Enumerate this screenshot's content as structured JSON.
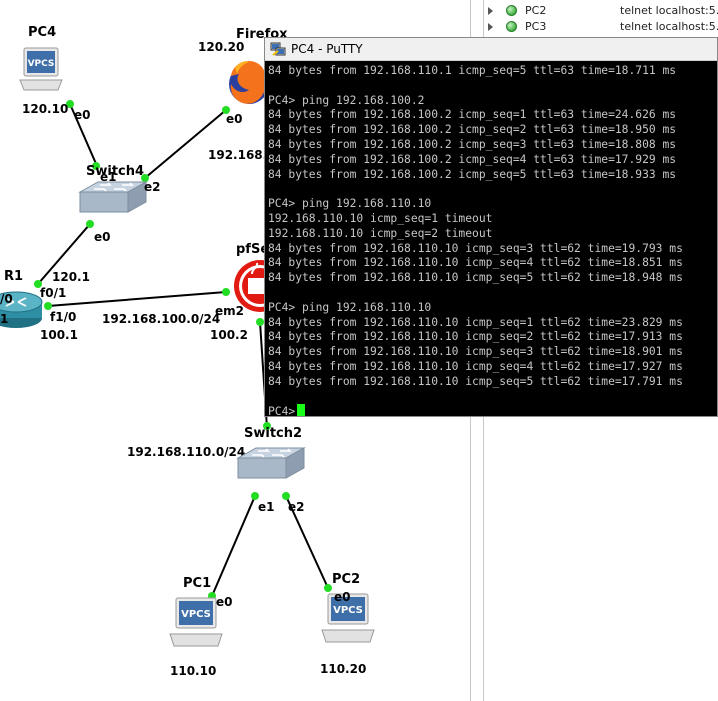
{
  "topology": {
    "nodes": {
      "pc4": {
        "name": "PC4",
        "ip": "120.10",
        "port": "e0",
        "icon_text": "VPCS"
      },
      "firefox": {
        "name": "Firefox",
        "ip_top": "120.20",
        "port": "e0",
        "ip_bottom": "192.168."
      },
      "switch4": {
        "name": "Switch4",
        "port_e1": "e1",
        "port_e2": "e2",
        "port_e0": "e0"
      },
      "r1": {
        "name": "R1",
        "ip_top": "120.1",
        "port_f01": "f0/1",
        "port_f10": "f1/0",
        "ip_bottom": "100.1",
        "port_left_top": "/0",
        "port_left_bottom": "1"
      },
      "pfsense": {
        "name": "pfSe",
        "port_em2": "em2",
        "ip": "100.2"
      },
      "switch2": {
        "name": "Switch2"
      },
      "pc1": {
        "name": "PC1",
        "port": "e0",
        "ip": "110.10",
        "icon_text": "VPCS"
      },
      "pc2": {
        "name": "PC2",
        "port": "e0",
        "ip": "110.20",
        "icon_text": "VPCS"
      }
    },
    "links": {
      "net_100": "192.168.100.0/24",
      "net_110": "192.168.110.0/24",
      "sw2_e1": "e1",
      "sw2_e2": "e2"
    }
  },
  "devices_panel": {
    "rows": [
      {
        "name": "PC2",
        "console": "telnet localhost:5...",
        "status": "started"
      },
      {
        "name": "PC3",
        "console": "telnet localhost:5...",
        "status": "started"
      }
    ]
  },
  "putty": {
    "title": "PC4 - PuTTY",
    "lines": [
      "84 bytes from 192.168.110.1 icmp_seq=5 ttl=63 time=18.711 ms",
      "",
      "PC4> ping 192.168.100.2",
      "84 bytes from 192.168.100.2 icmp_seq=1 ttl=63 time=24.626 ms",
      "84 bytes from 192.168.100.2 icmp_seq=2 ttl=63 time=18.950 ms",
      "84 bytes from 192.168.100.2 icmp_seq=3 ttl=63 time=18.808 ms",
      "84 bytes from 192.168.100.2 icmp_seq=4 ttl=63 time=17.929 ms",
      "84 bytes from 192.168.100.2 icmp_seq=5 ttl=63 time=18.933 ms",
      "",
      "PC4> ping 192.168.110.10",
      "192.168.110.10 icmp_seq=1 timeout",
      "192.168.110.10 icmp_seq=2 timeout",
      "84 bytes from 192.168.110.10 icmp_seq=3 ttl=62 time=19.793 ms",
      "84 bytes from 192.168.110.10 icmp_seq=4 ttl=62 time=18.851 ms",
      "84 bytes from 192.168.110.10 icmp_seq=5 ttl=62 time=18.948 ms",
      "",
      "PC4> ping 192.168.110.10",
      "84 bytes from 192.168.110.10 icmp_seq=1 ttl=62 time=23.829 ms",
      "84 bytes from 192.168.110.10 icmp_seq=2 ttl=62 time=17.913 ms",
      "84 bytes from 192.168.110.10 icmp_seq=3 ttl=62 time=18.901 ms",
      "84 bytes from 192.168.110.10 icmp_seq=4 ttl=62 time=17.927 ms",
      "84 bytes from 192.168.110.10 icmp_seq=5 ttl=62 time=17.791 ms",
      ""
    ],
    "prompt": "PC4>"
  },
  "colors": {
    "terminal_bg": "#000000",
    "terminal_fg": "#c6c6c6",
    "cursor": "#1aff1a",
    "link_dot": "#22dd22",
    "router": "#2e8ea3",
    "pfsense": "#e21b12"
  }
}
